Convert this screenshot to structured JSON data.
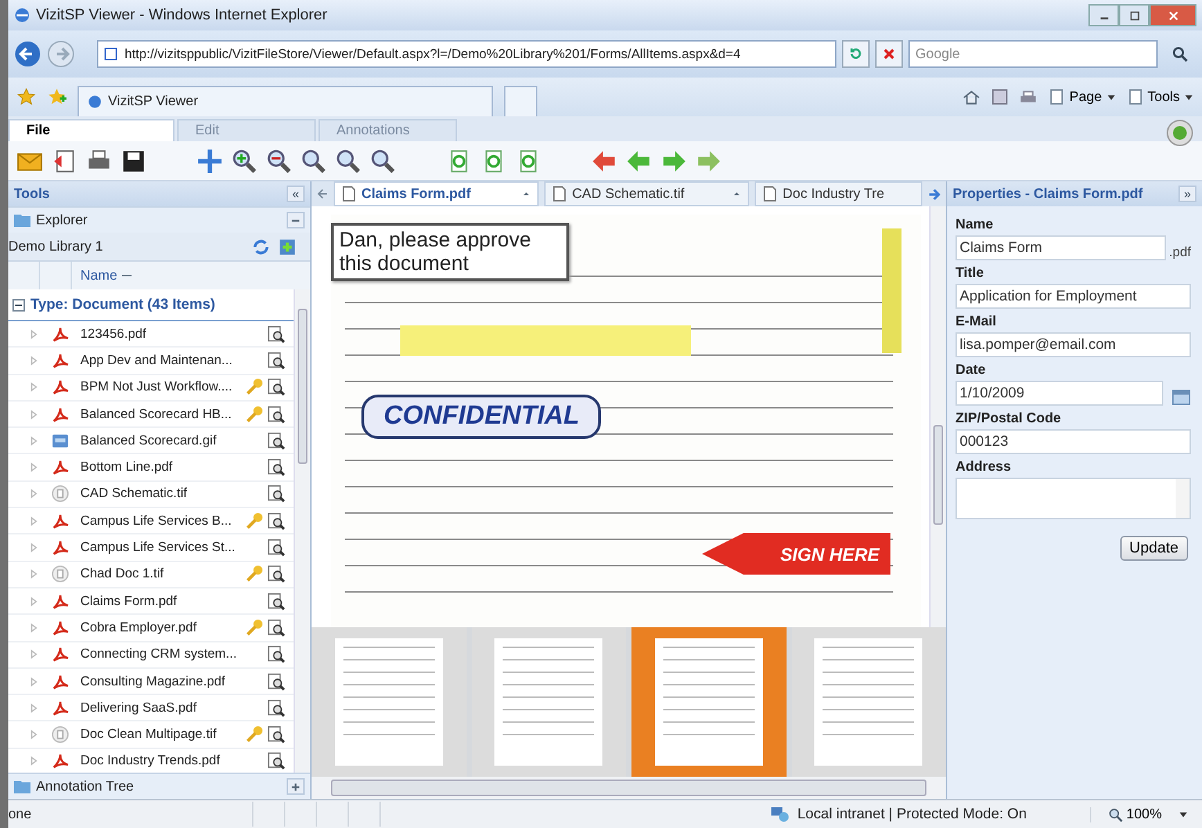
{
  "window": {
    "title": "VizitSP Viewer - Windows Internet Explorer"
  },
  "address_bar": {
    "url": "http://vizitsppublic/VizitFileStore/Viewer/Default.aspx?l=/Demo%20Library%201/Forms/AllItems.aspx&d=4",
    "search_placeholder": "Google"
  },
  "browser_tab": {
    "title": "VizitSP Viewer"
  },
  "command_bar": [
    "Page",
    "Tools"
  ],
  "app_tabs": [
    {
      "label": "File",
      "selected": true
    },
    {
      "label": "Edit",
      "selected": false
    },
    {
      "label": "Annotations",
      "selected": false
    }
  ],
  "tools_panel": {
    "title": "Tools",
    "collapse": "«",
    "explorer": "Explorer",
    "library": "Demo Library 1",
    "column": "Name",
    "group": "Type: Document (43 Items)",
    "footer": "Annotation Tree",
    "files": [
      {
        "name": "123456.pdf",
        "kind": "pdf",
        "locked": false
      },
      {
        "name": "App Dev and Maintenan...",
        "kind": "pdf",
        "locked": false
      },
      {
        "name": "BPM Not Just Workflow....",
        "kind": "pdf",
        "locked": true
      },
      {
        "name": "Balanced Scorecard HB...",
        "kind": "pdf",
        "locked": true
      },
      {
        "name": "Balanced Scorecard.gif",
        "kind": "gif",
        "locked": false
      },
      {
        "name": "Bottom Line.pdf",
        "kind": "pdf",
        "locked": false
      },
      {
        "name": "CAD Schematic.tif",
        "kind": "tif",
        "locked": false
      },
      {
        "name": "Campus Life Services B...",
        "kind": "pdf",
        "locked": true
      },
      {
        "name": "Campus Life Services St...",
        "kind": "pdf",
        "locked": false
      },
      {
        "name": "Chad Doc 1.tif",
        "kind": "tif",
        "locked": true
      },
      {
        "name": "Claims Form.pdf",
        "kind": "pdf",
        "locked": false
      },
      {
        "name": "Cobra Employer.pdf",
        "kind": "pdf",
        "locked": true
      },
      {
        "name": "Connecting CRM system...",
        "kind": "pdf",
        "locked": false
      },
      {
        "name": "Consulting Magazine.pdf",
        "kind": "pdf",
        "locked": false
      },
      {
        "name": "Delivering SaaS.pdf",
        "kind": "pdf",
        "locked": false
      },
      {
        "name": "Doc Clean Multipage.tif",
        "kind": "tif",
        "locked": true
      },
      {
        "name": "Doc Industry Trends.pdf",
        "kind": "pdf",
        "locked": false
      }
    ]
  },
  "document_tabs": [
    {
      "label": "Claims Form.pdf",
      "selected": true
    },
    {
      "label": "CAD Schematic.tif",
      "selected": false
    },
    {
      "label": "Doc Industry Tre",
      "selected": false
    }
  ],
  "annotations": {
    "note": "Dan, please approve this document",
    "stamp": "CONFIDENTIAL",
    "sign": "SIGN HERE"
  },
  "thumbnails": [
    {
      "selected": false
    },
    {
      "selected": false
    },
    {
      "selected": true
    },
    {
      "selected": false
    }
  ],
  "properties": {
    "title": "Properties - Claims Form.pdf",
    "collapse": "»",
    "button": "Update",
    "fields": [
      {
        "label": "Name",
        "value": "Claims Form",
        "suffix": ".pdf",
        "kind": "text"
      },
      {
        "label": "Title",
        "value": "Application for Employment",
        "kind": "text"
      },
      {
        "label": "E-Mail",
        "value": "lisa.pomper@email.com",
        "kind": "text"
      },
      {
        "label": "Date",
        "value": "1/10/2009",
        "kind": "date"
      },
      {
        "label": "ZIP/Postal Code",
        "value": "000123",
        "kind": "text"
      },
      {
        "label": "Address",
        "kind": "textarea"
      }
    ]
  },
  "status_bar": {
    "text": "one",
    "zone": "Local intranet | Protected Mode: On",
    "zoom": "100%"
  }
}
